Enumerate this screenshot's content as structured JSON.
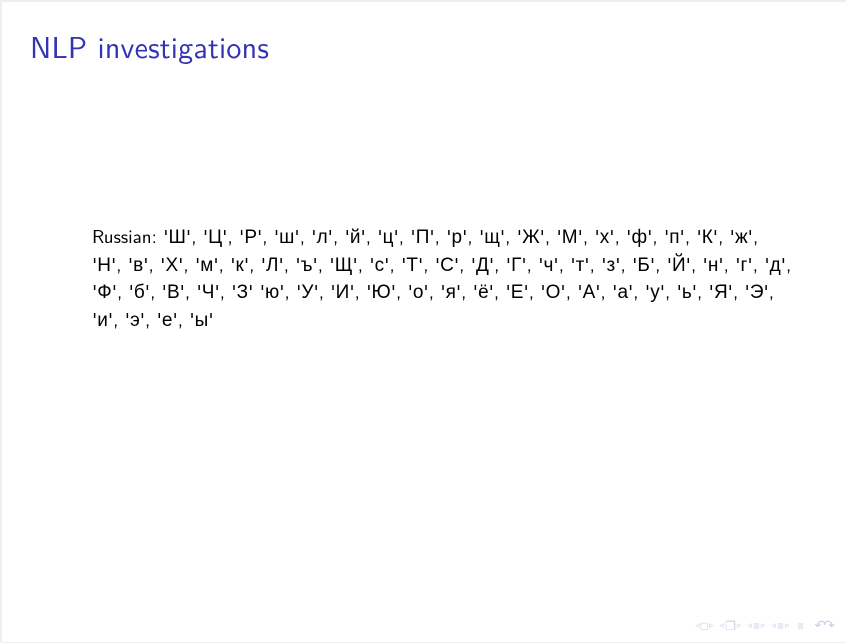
{
  "title": "NLP investigations",
  "content": {
    "label": "Russian:",
    "list": "'Ш', 'Ц', 'Р', 'ш', 'л', 'й', 'ц', 'П', 'р', 'щ', 'Ж', 'М', 'х', 'ф', 'п', 'К', 'ж', 'Н', 'в', 'Х', 'м', 'к', 'Л', 'ъ', 'Щ', 'с', 'Т', 'С', 'Д', 'Г', 'ч', 'т', 'з', 'Б', 'Й', 'н', 'г', 'д', 'Ф', 'б', 'В', 'Ч', 'З' 'ю', 'У', 'И', 'Ю', 'о', 'я', 'ё', 'Е', 'О', 'А', 'а', 'у', 'ь', 'Я', 'Э', 'и', 'э', 'е', 'ы'"
  },
  "nav": {
    "first_glyph": "◃",
    "sep_glyph": "▹",
    "box_glyph": "□",
    "page_glyph": "❐",
    "line_glyph": "≡",
    "back_glyph": "↶↷"
  }
}
